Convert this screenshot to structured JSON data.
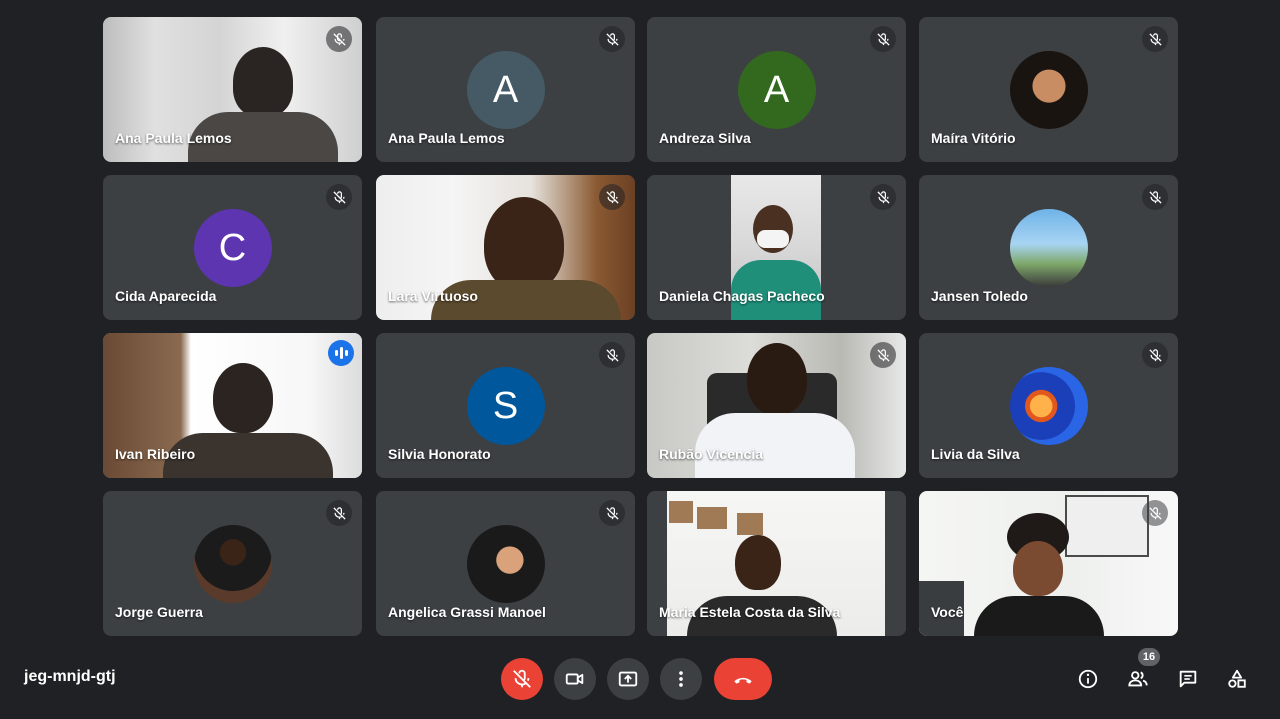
{
  "participants": [
    {
      "name": "Ana Paula Lemos",
      "kind": "video",
      "muted": true
    },
    {
      "name": "Ana Paula Lemos",
      "kind": "letter",
      "initial": "A",
      "color": "#455a64",
      "muted": true
    },
    {
      "name": "Andreza Silva",
      "kind": "letter",
      "initial": "A",
      "color": "#33691e",
      "muted": true
    },
    {
      "name": "Maíra Vitório",
      "kind": "photo",
      "muted": true
    },
    {
      "name": "Cida Aparecida",
      "kind": "letter",
      "initial": "C",
      "color": "#5e35b1",
      "muted": true
    },
    {
      "name": "Lara Virtuoso",
      "kind": "video",
      "muted": true
    },
    {
      "name": "Daniela Chagas Pacheco",
      "kind": "video",
      "muted": true
    },
    {
      "name": "Jansen Toledo",
      "kind": "photo",
      "muted": true
    },
    {
      "name": "Ivan Ribeiro",
      "kind": "video",
      "speaking": true
    },
    {
      "name": "Silvia Honorato",
      "kind": "letter",
      "initial": "S",
      "color": "#01579b",
      "muted": true
    },
    {
      "name": "Rubão Vicencia",
      "kind": "video",
      "muted": true
    },
    {
      "name": "Livia da Silva",
      "kind": "photo",
      "muted": true
    },
    {
      "name": "Jorge Guerra",
      "kind": "photo",
      "muted": true
    },
    {
      "name": "Angelica Grassi Manoel",
      "kind": "photo",
      "muted": true
    },
    {
      "name": "Maria Estela Costa da Silva",
      "kind": "video",
      "muted": false
    },
    {
      "name": "Você",
      "kind": "video",
      "muted": true
    }
  ],
  "meeting": {
    "code": "jeg-mnjd-gtj",
    "people_count": "16"
  },
  "controls": [
    "mic-off-icon",
    "camera-icon",
    "present-screen-icon",
    "more-options-icon",
    "hang-up-icon"
  ],
  "side_controls": [
    "info-icon",
    "people-icon",
    "chat-icon",
    "activities-icon"
  ],
  "colors": {
    "background": "#202124",
    "tile": "#3c4043",
    "danger": "#ea4335",
    "active_speaker": "#8ab4f8"
  }
}
